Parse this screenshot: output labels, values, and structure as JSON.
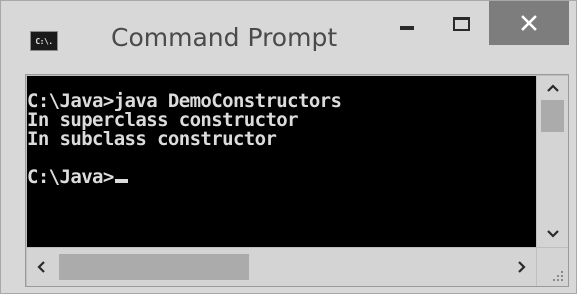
{
  "window": {
    "title": "Command Prompt",
    "app_icon_label": "C:\\.",
    "close_icon": "close-icon",
    "minimize_icon": "minimize-icon",
    "maximize_icon": "maximize-icon"
  },
  "console": {
    "lines": [
      "C:\\Java>java DemoConstructors",
      "In superclass constructor",
      "In subclass constructor",
      "",
      "C:\\Java>"
    ]
  },
  "scrollbars": {
    "vertical": {
      "up_icon": "chevron-up-icon",
      "down_icon": "chevron-down-icon"
    },
    "horizontal": {
      "left_icon": "chevron-left-icon",
      "right_icon": "chevron-right-icon"
    }
  },
  "colors": {
    "console_bg": "#000000",
    "console_text": "#dcdcdc",
    "titlebar_bg": "#d8d8d8",
    "close_button_bg": "#7d7d7d"
  }
}
